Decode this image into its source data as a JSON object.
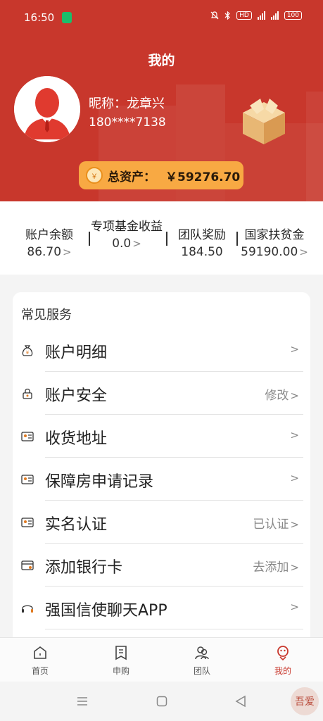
{
  "status_bar": {
    "time": "16:50",
    "battery": "100",
    "network": "4G",
    "hd": "HD"
  },
  "header": {
    "title": "我的",
    "nickname": "昵称：龙章兴",
    "phone": "180****7138",
    "total_assets_label": "总资产：",
    "total_assets_value": "￥59276.70",
    "coin_glyph": "￥"
  },
  "stats": [
    {
      "label": "账户余额",
      "value": "86.70"
    },
    {
      "label": "专项基金收益",
      "value": "0.0"
    },
    {
      "label": "团队奖励",
      "value": "184.50"
    },
    {
      "label": "国家扶贫金",
      "value": "59190.00"
    }
  ],
  "services": {
    "title": "常见服务",
    "items": [
      {
        "label": "账户明细",
        "right": "",
        "icon": "money-bag-icon"
      },
      {
        "label": "账户安全",
        "right": "修改",
        "icon": "lock-icon"
      },
      {
        "label": "收货地址",
        "right": "",
        "icon": "id-card-icon"
      },
      {
        "label": "保障房申请记录",
        "right": "",
        "icon": "id-card-icon"
      },
      {
        "label": "实名认证",
        "right": "已认证",
        "icon": "id-card-icon"
      },
      {
        "label": "添加银行卡",
        "right": "去添加",
        "icon": "bank-card-icon"
      },
      {
        "label": "强国信使聊天APP",
        "right": "",
        "icon": "headset-icon"
      }
    ]
  },
  "tabs": [
    {
      "label": "首页",
      "icon": "home-icon"
    },
    {
      "label": "申购",
      "icon": "bookmark-icon"
    },
    {
      "label": "团队",
      "icon": "team-icon"
    },
    {
      "label": "我的",
      "icon": "profile-icon",
      "active": true
    }
  ],
  "watermark": "吾爱",
  "colors": {
    "primary": "#c8372c",
    "assets_badge": "#f8a943"
  }
}
